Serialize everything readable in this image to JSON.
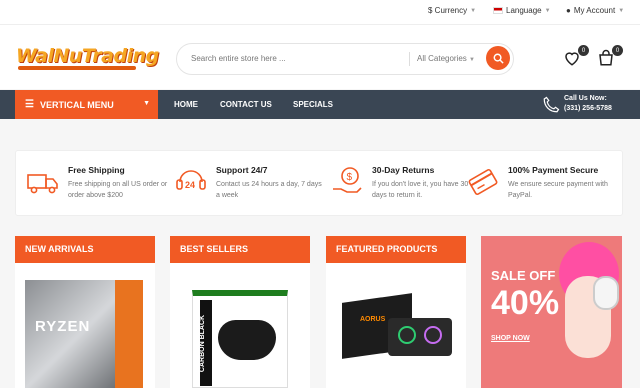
{
  "topbar": {
    "currency": "$ Currency",
    "language": "Language",
    "account": "My Account"
  },
  "header": {
    "logo": "WalNuTrading",
    "search_placeholder": "Search entire store here ...",
    "categories": "All Categories",
    "wishlist_count": "0",
    "cart_count": "0"
  },
  "nav": {
    "vertical_menu": "VERTICAL MENU",
    "links": [
      "HOME",
      "CONTACT US",
      "SPECIALS"
    ],
    "call_title": "Call Us Now:",
    "phone": "(331) 256-5788"
  },
  "features": [
    {
      "title": "Free Shipping",
      "desc": "Free shipping on all US order or order above $200",
      "icon": "truck-icon"
    },
    {
      "title": "Support 24/7",
      "desc": "Contact us 24 hours a day, 7 days a week",
      "icon": "support-24-icon"
    },
    {
      "title": "30-Day Returns",
      "desc": "If you don't love it, you have 30 days to return it.",
      "icon": "money-return-icon"
    },
    {
      "title": "100% Payment Secure",
      "desc": "We ensure secure payment with PayPal.",
      "icon": "credit-card-icon"
    }
  ],
  "columns": [
    {
      "title": "NEW ARRIVALS",
      "product": "RYZEN"
    },
    {
      "title": "BEST SELLERS",
      "product": "CARBON BLACK"
    },
    {
      "title": "FEATURED PRODUCTS",
      "product": "AORUS"
    }
  ],
  "promo": {
    "line1": "SALE OFF",
    "line2": "40%",
    "cta": "SHOP NOW"
  },
  "colors": {
    "accent": "#f15a24",
    "nav_bg": "#3a4654",
    "promo_bg": "#ee7a7a"
  }
}
